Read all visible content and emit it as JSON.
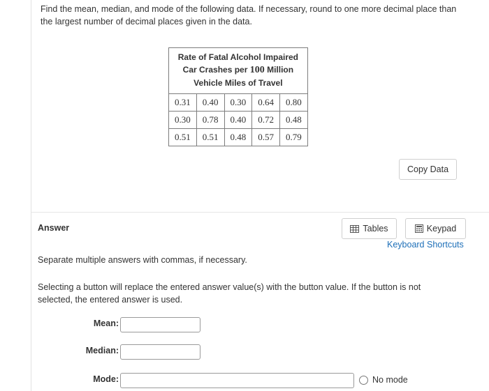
{
  "question": {
    "text": "Find the mean, median, and mode of the following data. If necessary, round to one more decimal place than the largest number of decimal places given in the data."
  },
  "table": {
    "title_line1": "Rate of Fatal Alcohol Impaired",
    "title_line2_pre": "Car Crashes per",
    "title_line2_num": "100",
    "title_line2_post": "Million",
    "title_line3": "Vehicle Miles of Travel",
    "rows": [
      [
        "0.31",
        "0.40",
        "0.30",
        "0.64",
        "0.80"
      ],
      [
        "0.30",
        "0.78",
        "0.40",
        "0.72",
        "0.48"
      ],
      [
        "0.51",
        "0.51",
        "0.48",
        "0.57",
        "0.79"
      ]
    ]
  },
  "buttons": {
    "copy_data": "Copy Data",
    "tables": "Tables",
    "keypad": "Keypad",
    "keyboard_shortcuts": "Keyboard Shortcuts"
  },
  "answer": {
    "label": "Answer",
    "note1": "Separate multiple answers with commas, if necessary.",
    "note2": "Selecting a button will replace the entered answer value(s) with the button value. If the button is not selected, the entered answer is used.",
    "mean_label": "Mean:",
    "median_label": "Median:",
    "mode_label": "Mode:",
    "mean_value": "",
    "median_value": "",
    "mode_value": "",
    "no_mode_label": "No mode"
  },
  "colors": {
    "link": "#1d6fb8",
    "border": "#7d7d7d"
  }
}
